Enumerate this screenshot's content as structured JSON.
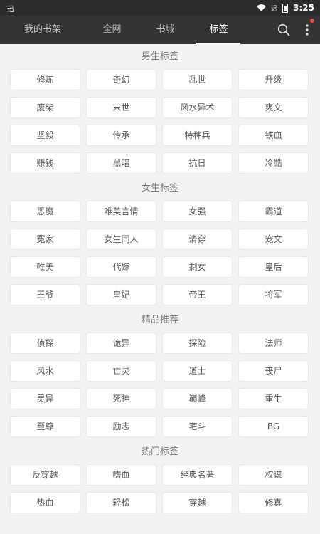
{
  "status_bar": {
    "left_text": "迅",
    "sim_label": "迟",
    "time": "3:25"
  },
  "nav": {
    "tabs": [
      {
        "label": "我的书架",
        "active": false
      },
      {
        "label": "全网",
        "active": false
      },
      {
        "label": "书城",
        "active": false
      },
      {
        "label": "标签",
        "active": true
      }
    ],
    "accent_color": "#ffffff",
    "notification_dot_color": "#e54848"
  },
  "sections": [
    {
      "title": "男生标签",
      "tags": [
        "修炼",
        "奇幻",
        "乱世",
        "升级",
        "废柴",
        "末世",
        "风水异术",
        "爽文",
        "坚毅",
        "传承",
        "特种兵",
        "铁血",
        "赚钱",
        "黑暗",
        "抗日",
        "冷酷"
      ]
    },
    {
      "title": "女生标签",
      "tags": [
        "恶魔",
        "唯美言情",
        "女强",
        "霸道",
        "冤家",
        "女生同人",
        "清穿",
        "宠文",
        "唯美",
        "代嫁",
        "剩女",
        "皇后",
        "王爷",
        "皇妃",
        "帝王",
        "将军"
      ]
    },
    {
      "title": "精品推荐",
      "tags": [
        "侦探",
        "诡异",
        "探险",
        "法师",
        "风水",
        "亡灵",
        "道士",
        "丧尸",
        "灵异",
        "死神",
        "巅峰",
        "重生",
        "至尊",
        "励志",
        "宅斗",
        "BG"
      ]
    },
    {
      "title": "热门标签",
      "tags": [
        "反穿越",
        "嗜血",
        "经典名著",
        "权谋",
        "热血",
        "轻松",
        "穿越",
        "修真"
      ]
    }
  ]
}
